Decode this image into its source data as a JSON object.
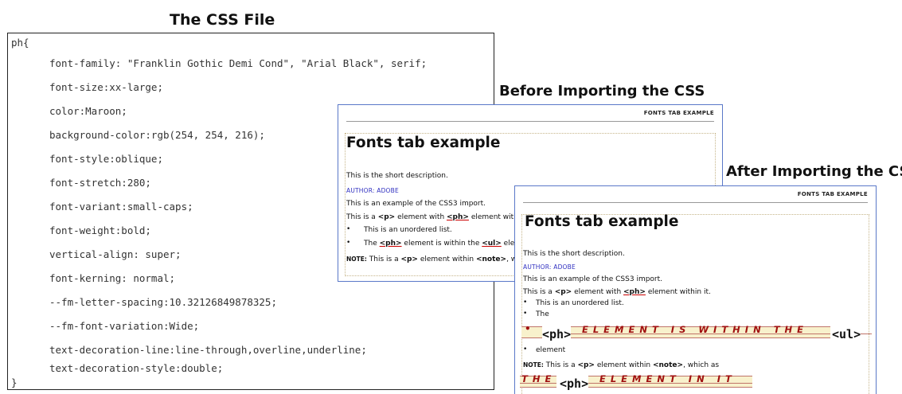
{
  "headings": {
    "css_file": "The CSS File",
    "before": "Before Importing the CSS",
    "after": "After Importing the CSS"
  },
  "css_file": {
    "selector": "ph{",
    "declarations": [
      "font-family: \"Franklin Gothic Demi Cond\", \"Arial Black\", serif;",
      "font-size:xx-large;",
      "color:Maroon;",
      "background-color:rgb(254, 254, 216);",
      "font-style:oblique;",
      "font-stretch:280;",
      "font-variant:small-caps;",
      "font-weight:bold;",
      "vertical-align: super;",
      "font-kerning: normal;",
      "--fm-letter-spacing:10.32126849878325;",
      "--fm-font-variation:Wide;",
      "text-decoration-line:line-through,overline,underline;",
      "text-decoration-style:double;"
    ],
    "closing": "}"
  },
  "doc": {
    "header_label": "FONTS TAB EXAMPLE",
    "title": "Fonts tab example",
    "short_desc": "This is the short description.",
    "author": "AUTHOR: ADOBE",
    "line_css3": "This is an example of the CSS3 import.",
    "p_prefix": "This is a ",
    "p_tag": "<p>",
    "p_mid": " element with ",
    "ph_tag": "<ph>",
    "p_suffix_before": " element withi",
    "p_suffix_after": " element within it.",
    "li_unordered": "This is an unordered list.",
    "li_the": "The ",
    "li_mid_before": " element is within the ",
    "ul_tag": "<ul>",
    "li_end_before": " eler",
    "note_label": "NOTE:",
    "note_prefix": " This is a ",
    "note_mid": " element within ",
    "note_tag": "<note>",
    "note_suffix_before": ", wh",
    "note_suffix_after": ", which as"
  },
  "after_styled": {
    "li_the": "The",
    "bullet": "•",
    "ph": "<ph>",
    "styled_text_1": "ELEMENT IS WITHIN THE",
    "ul": "<ul>",
    "element": "element",
    "styled_the": "THE",
    "styled_text_2": "ELEMENT IN IT"
  },
  "colors": {
    "window_border": "#5a78c8",
    "author_blue": "#3030c0",
    "maroon": "#a01010",
    "ph_background": "#f8f1cc"
  }
}
